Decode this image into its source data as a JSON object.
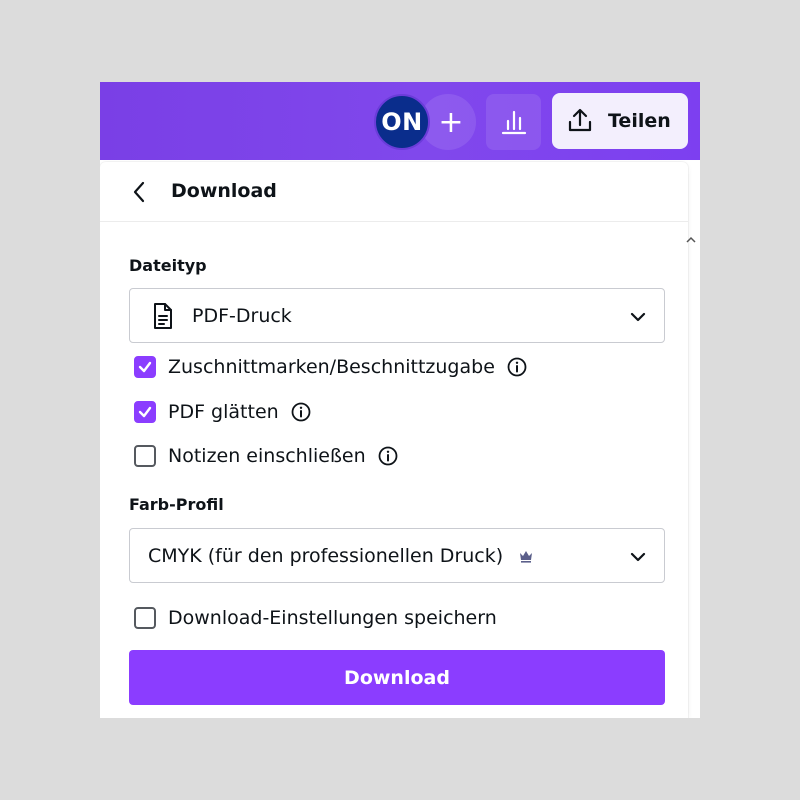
{
  "topbar": {
    "avatar_initials": "ON",
    "add_symbol": "+",
    "share_label": "Teilen",
    "icons": {
      "add": "plus-icon",
      "stats": "bar-chart-icon",
      "share": "share-upload-icon"
    }
  },
  "panel": {
    "title": "Download",
    "back_icon": "chevron-left-icon",
    "file_type": {
      "label": "Dateityp",
      "selected": "PDF-Druck",
      "icon": "document-icon"
    },
    "options": [
      {
        "label": "Zuschnittmarken/Beschnittzugabe",
        "checked": true
      },
      {
        "label": "PDF glätten",
        "checked": true
      },
      {
        "label": "Notizen einschließen",
        "checked": false
      }
    ],
    "color_profile": {
      "label": "Farb-Profil",
      "selected": "CMYK (für den professionellen Druck)",
      "icon": "crown-icon"
    },
    "save_settings": {
      "label": "Download-Einstellungen speichern",
      "checked": false
    },
    "download_button": "Download"
  },
  "colors": {
    "accent": "#8b3dff",
    "topbar": "#7d3ff0",
    "avatar": "#0a2d8c"
  }
}
